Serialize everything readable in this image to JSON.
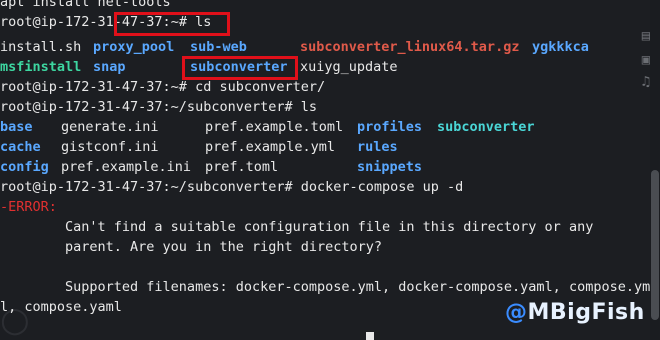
{
  "terminal": {
    "lines": [
      {
        "text": "apt install net-tools"
      },
      {
        "p1": "root@ip-172-31-",
        "p2": "47-37:~# ls"
      },
      {
        "a": "install.sh",
        "b": "proxy_pool",
        "c": "sub-web",
        "d": "subconverter_linux64.tar.gz",
        "e": "ygkkkca"
      },
      {
        "a": "msfinstall",
        "b": "snap",
        "c": "subconverter",
        "d": "xuiyg_update"
      },
      {
        "text": "root@ip-172-31-47-37:~# cd subconverter/"
      },
      {
        "text": "root@ip-172-31-47-37:~/subconverter# ls"
      },
      {
        "a": "base",
        "b": "generate.ini",
        "c": "pref.example.toml",
        "d": "profiles",
        "e": "subconverter"
      },
      {
        "a": "cache",
        "b": "gistconf.ini",
        "c": "pref.example.yml",
        "d": "rules"
      },
      {
        "a": "config",
        "b": "pref.example.ini",
        "c": "pref.toml",
        "d": "snippets"
      },
      {
        "text": "root@ip-172-31-47-37:~/subconverter# docker-compose up -d"
      },
      {
        "text": "-ERROR:"
      },
      {
        "text": "        Can't find a suitable configuration file in this directory or any"
      },
      {
        "text": "        parent. Are you in the right directory?"
      },
      {
        "text": ""
      },
      {
        "text": "        Supported filenames: docker-compose.yml, docker-compose.yaml, compose.ym"
      },
      {
        "text": "l, compose.yaml"
      }
    ]
  },
  "watermark": {
    "at": "@",
    "name": "MBigFish"
  },
  "icons": [
    "image-icon",
    "music-icon",
    "doc-icon"
  ]
}
